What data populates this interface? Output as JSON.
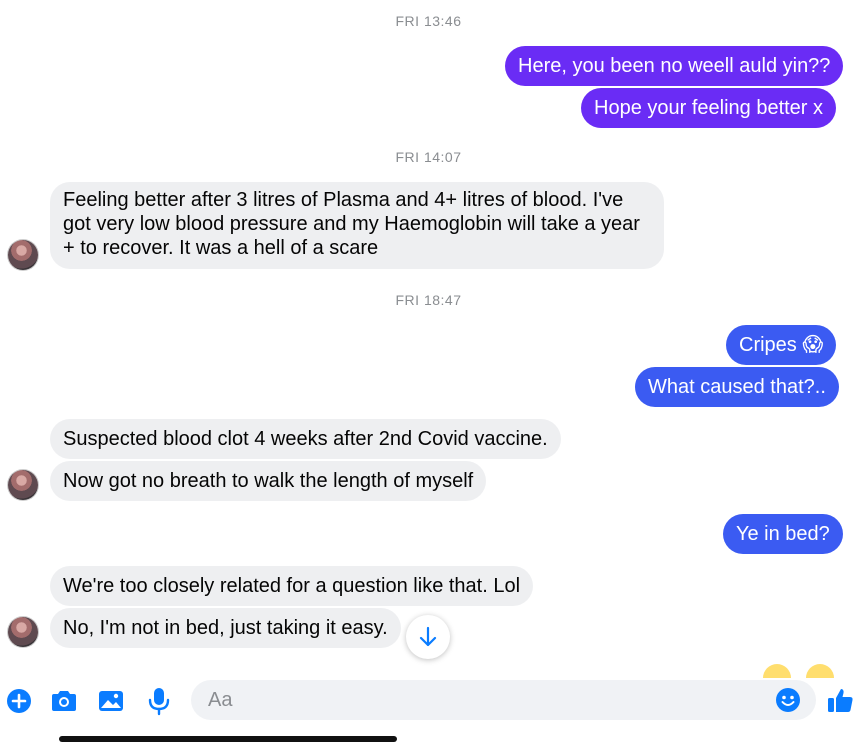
{
  "timestamps": [
    "FRI 13:46",
    "FRI 14:07",
    "FRI 18:47"
  ],
  "messages": {
    "m1": "Here, you been no weell auld yin??",
    "m2": "Hope your feeling better x",
    "m3_l1": "Feeling better after 3 litres of Plasma and 4+ litres of blood.  I've",
    "m3_l2": "got very low blood pressure and my Haemoglobin will take a year",
    "m3_l3": "+ to recover. It was a hell of a scare",
    "m4": "Cripes 😱",
    "m5": "What caused that?..",
    "m6": "Suspected blood clot 4 weeks after 2nd Covid vaccine.",
    "m7": "Now got no breath to walk the length of myself",
    "m8": "Ye in bed?",
    "m9": "We're too closely related for a question like that. Lol",
    "m10": "No, I'm not in bed, just taking it easy."
  },
  "composer": {
    "placeholder": "Aa",
    "icons": [
      "plus-icon",
      "camera-icon",
      "image-icon",
      "microphone-icon",
      "emoji-icon",
      "thumbs-up-icon"
    ]
  },
  "colors": {
    "outgoing_purple": "#6a2cf5",
    "outgoing_blue": "#3b5bf2",
    "incoming_gray": "#eeeff1",
    "messenger_blue": "#0a7cff"
  }
}
